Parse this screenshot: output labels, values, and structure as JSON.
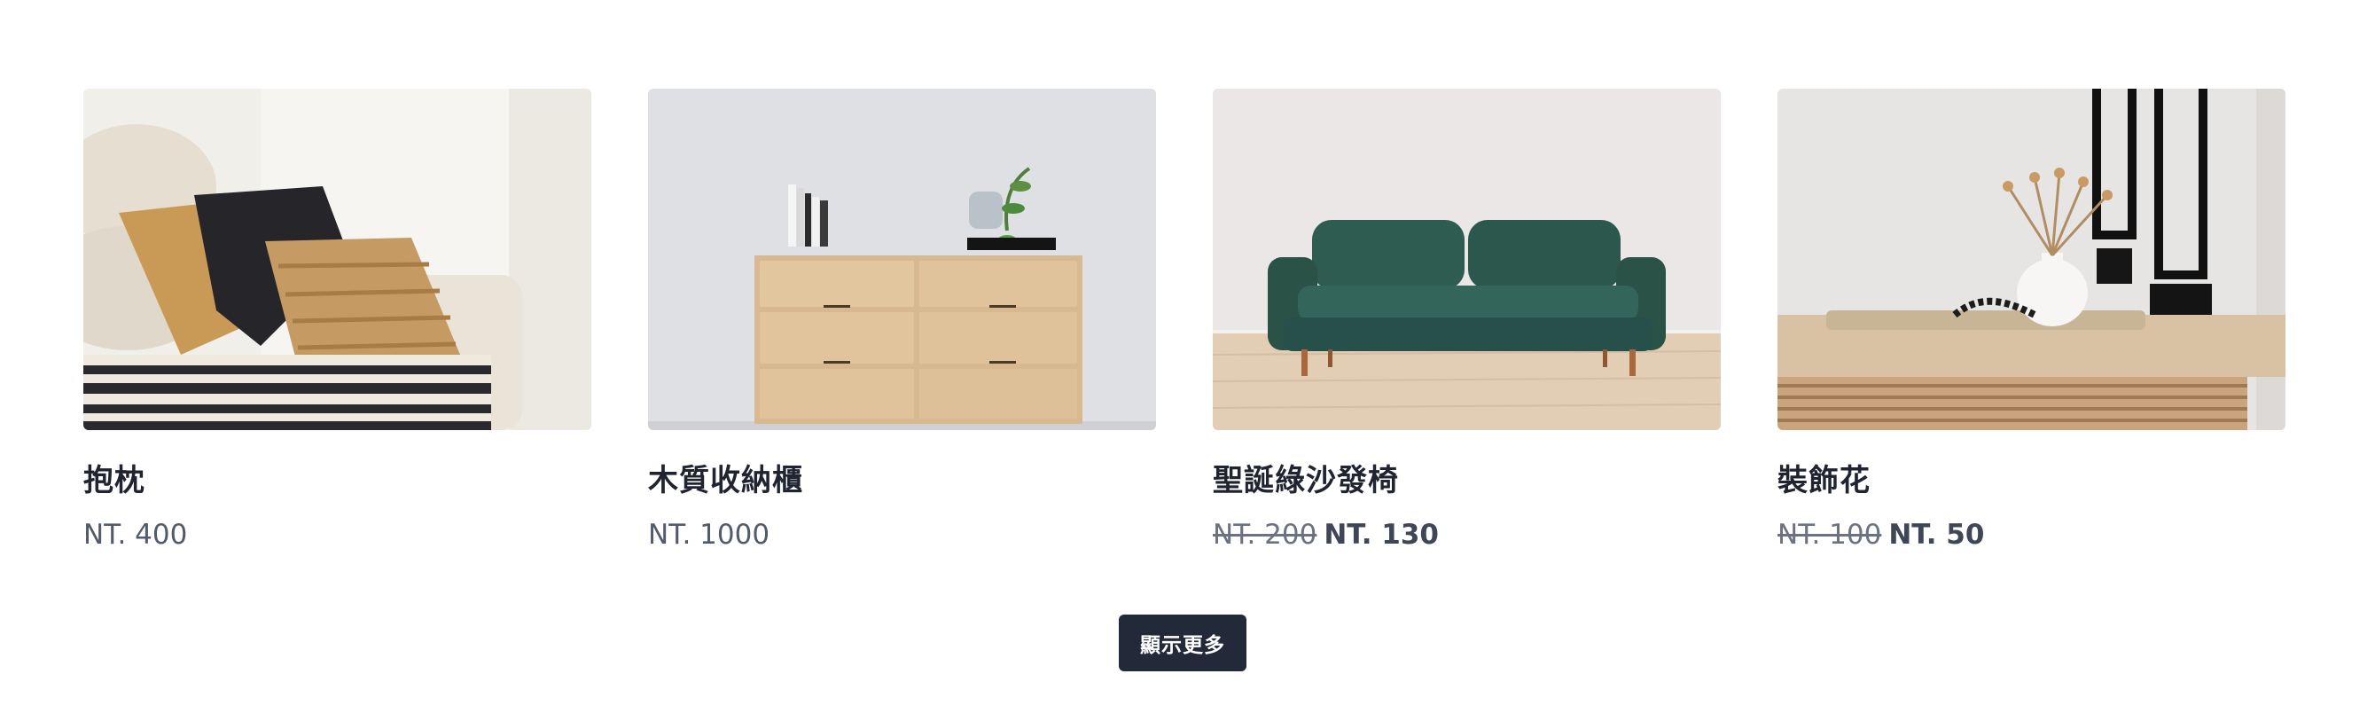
{
  "products": [
    {
      "name": "抱枕",
      "price": "NT. 400",
      "image": "pillows-on-sofa"
    },
    {
      "name": "木質收納櫃",
      "price": "NT. 1000",
      "image": "wooden-dresser"
    },
    {
      "name": "聖誕綠沙發椅",
      "price_original": "NT. 200",
      "price_sale": "NT. 130",
      "image": "green-velvet-sofa"
    },
    {
      "name": "裝飾花",
      "price_original": "NT. 100",
      "price_sale": "NT. 50",
      "image": "vase-with-dried-flowers"
    }
  ],
  "show_more_label": "顯示更多",
  "colors": {
    "button_bg": "#222a39",
    "name_text": "#1f2430",
    "price_text": "#525b6b"
  }
}
